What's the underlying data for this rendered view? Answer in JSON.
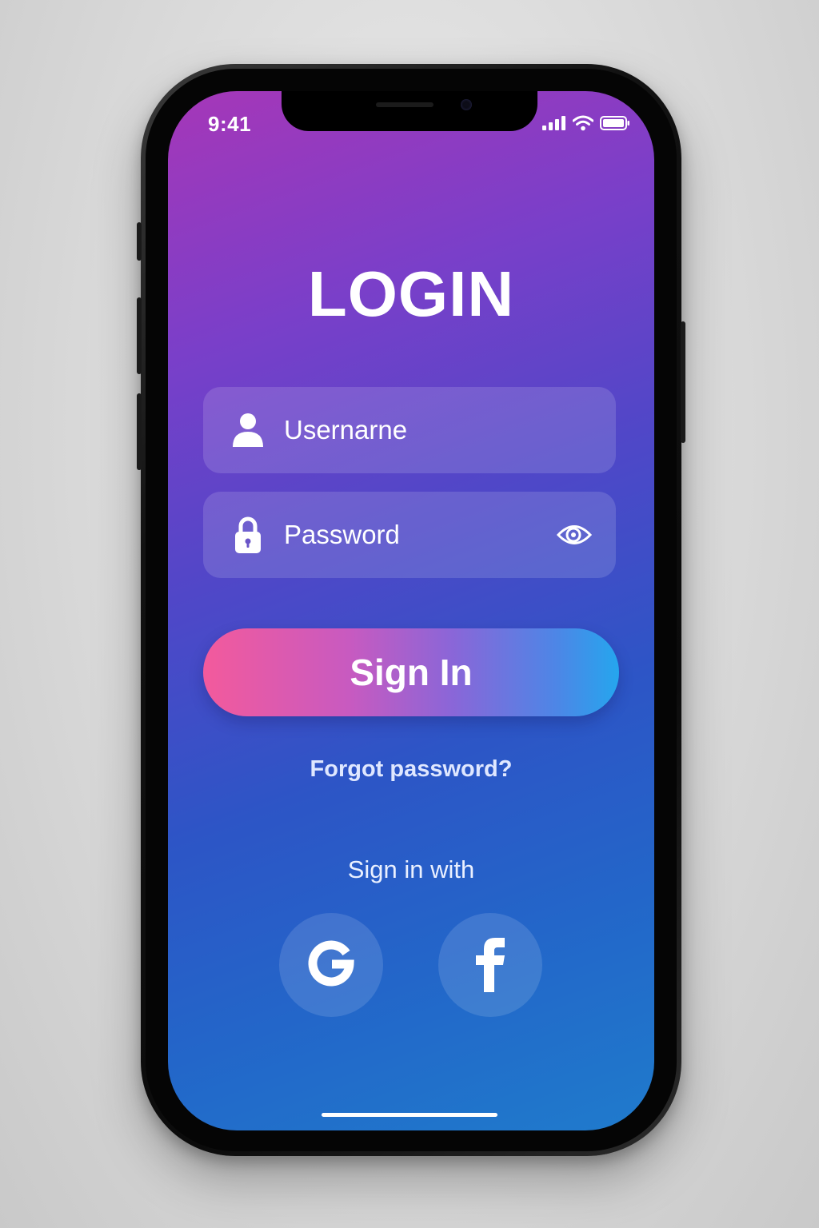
{
  "status_bar": {
    "time": "9:41",
    "signal_icon": "cellular-signal-icon",
    "wifi_icon": "wifi-icon",
    "battery_icon": "battery-icon"
  },
  "login": {
    "title": "LOGIN",
    "username_placeholder": "Usernarne",
    "password_placeholder": "Password",
    "user_icon": "user-icon",
    "lock_icon": "lock-icon",
    "visibility_icon": "eye-icon",
    "sign_in_label": "Sign In",
    "forgot_label": "Forgot password?",
    "sign_in_with_label": "Sign in with"
  },
  "social": [
    {
      "name": "Google",
      "icon": "google-icon"
    },
    {
      "name": "Facebook",
      "icon": "facebook-icon"
    }
  ],
  "colors": {
    "background_top": "#a637b8",
    "background_mid": "#2d55c6",
    "background_bottom": "#1f7bcc",
    "button_start": "#f35a9c",
    "button_end": "#25a6ee",
    "text": "#ffffff"
  }
}
